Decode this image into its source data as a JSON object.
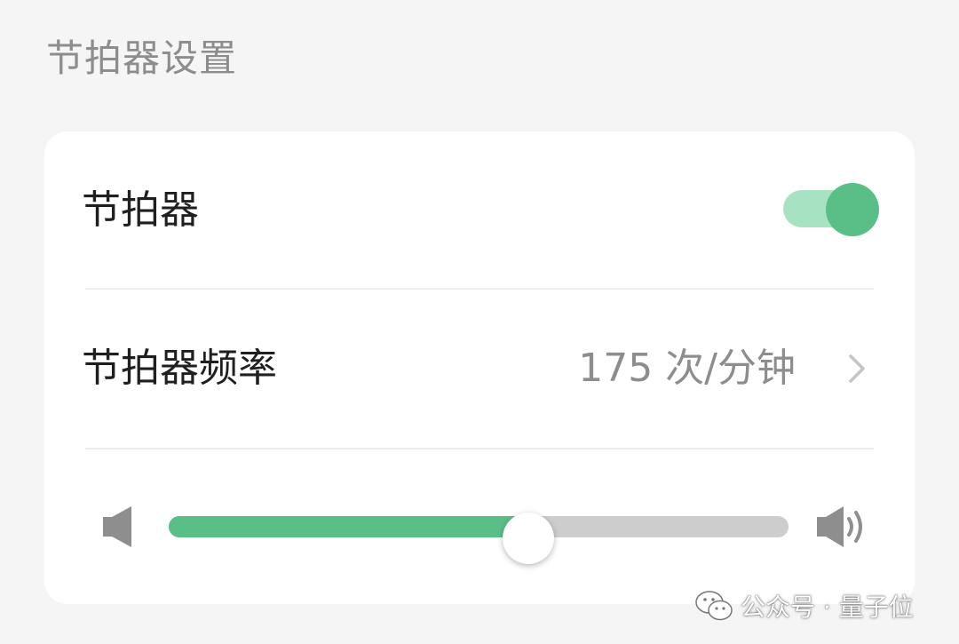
{
  "page": {
    "section_title": "节拍器设置"
  },
  "metronome": {
    "label": "节拍器",
    "enabled": true
  },
  "frequency": {
    "label": "节拍器频率",
    "value": "175 次/分钟",
    "chevron_icon": "chevron-right-icon"
  },
  "volume": {
    "level": 0.58,
    "low_icon": "volume-low-icon",
    "high_icon": "volume-high-icon"
  },
  "watermark": {
    "text": "公众号 · 量子位",
    "icon": "wechat-icon"
  },
  "colors": {
    "accent": "#5abf86",
    "accent_light": "#a7e2c3",
    "track_gray": "#cdcdcd",
    "secondary_text": "#8d8d8d",
    "primary_text": "#1f1f1f"
  }
}
